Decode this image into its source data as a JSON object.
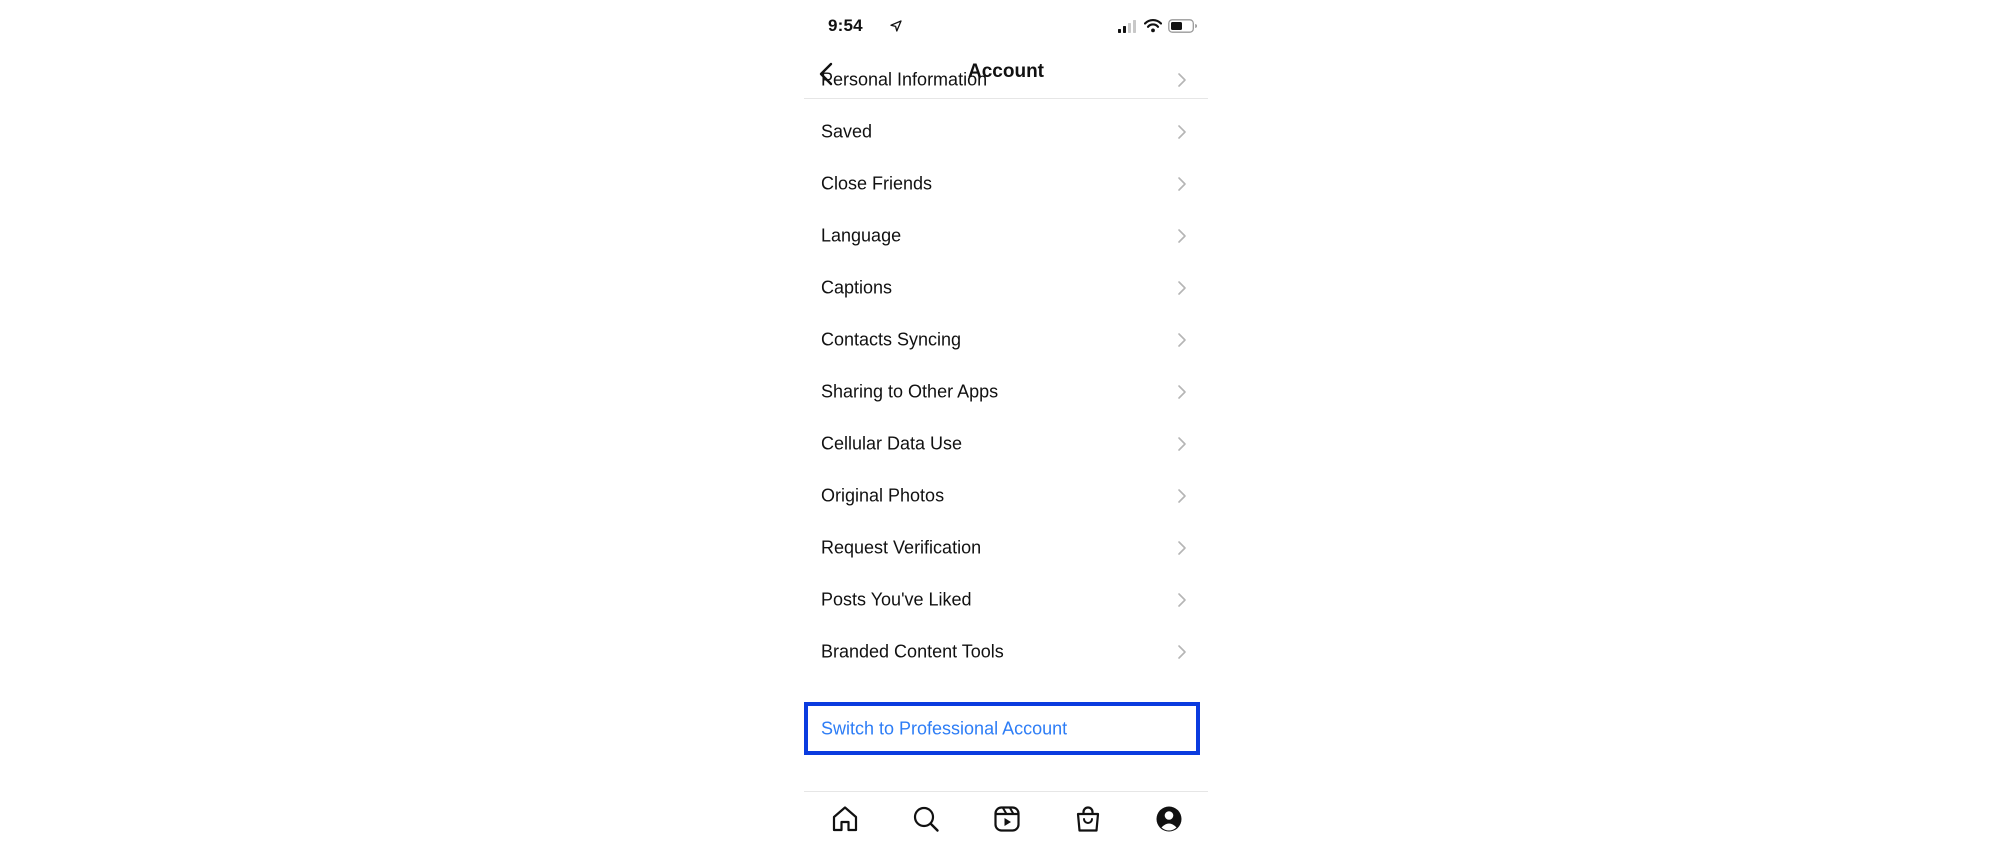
{
  "status_bar": {
    "time": "9:54"
  },
  "header": {
    "title": "Account"
  },
  "menu": {
    "items": [
      {
        "label": "Personal Information"
      },
      {
        "label": "Saved"
      },
      {
        "label": "Close Friends"
      },
      {
        "label": "Language"
      },
      {
        "label": "Captions"
      },
      {
        "label": "Contacts Syncing"
      },
      {
        "label": "Sharing to Other Apps"
      },
      {
        "label": "Cellular Data Use"
      },
      {
        "label": "Original Photos"
      },
      {
        "label": "Request Verification"
      },
      {
        "label": "Posts You've Liked"
      },
      {
        "label": "Branded Content Tools"
      }
    ],
    "professional_link": "Switch to Professional Account"
  },
  "tab_bar": {
    "tabs": [
      "home-icon",
      "search-icon",
      "reels-icon",
      "shop-icon",
      "profile-icon"
    ]
  },
  "colors": {
    "link_blue": "#2d7df6",
    "highlight_border": "#0a3bdf",
    "chevron": "#b5b5b5"
  }
}
